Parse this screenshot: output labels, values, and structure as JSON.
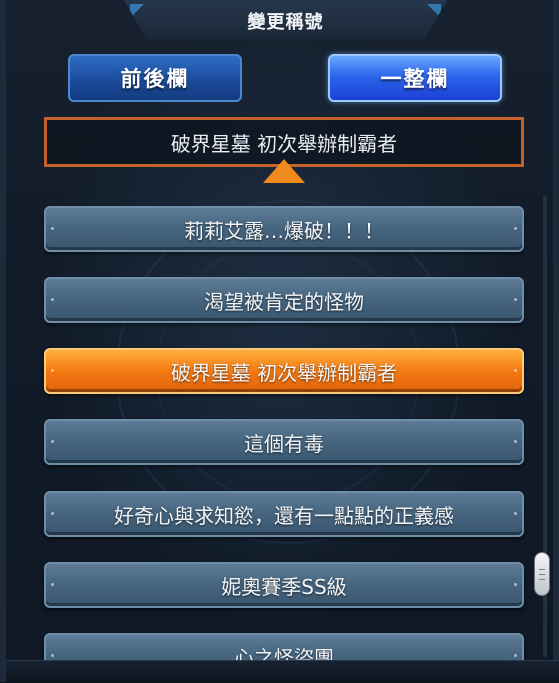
{
  "header": {
    "title": "變更稱號"
  },
  "tabs": {
    "back_label": "前後欄",
    "whole_label": "一整欄"
  },
  "current_title": "破界星墓 初次舉辦制霸者",
  "titles": [
    "莉莉艾露…爆破！！！",
    "渴望被肯定的怪物",
    "破界星墓 初次舉辦制霸者",
    "這個有毒",
    "好奇心與求知慾，還有一點點的正義感",
    "妮奧賽季SS級",
    "心之怪盜團"
  ],
  "selected_title": "破界星墓 初次舉辦制霸者",
  "colors": {
    "accent_selected": "#f47a12",
    "list_item": "#476680",
    "frame_highlight": "#c4622a"
  },
  "icons": {
    "pointer": "triangle-up-icon"
  }
}
